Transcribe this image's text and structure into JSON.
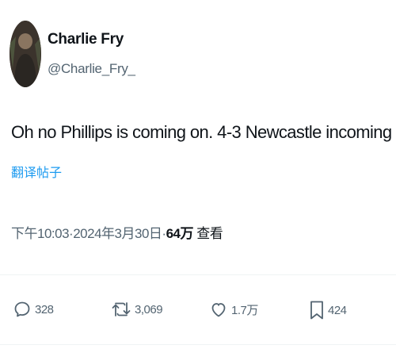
{
  "author": {
    "display_name": "Charlie Fry",
    "handle": "@Charlie_Fry_"
  },
  "tweet": {
    "text": "Oh no Phillips is coming on. 4-3 Newcastle incoming",
    "translate_label": "翻译帖子",
    "time": "下午10:03",
    "separator": "·",
    "date": "2024年3月30日",
    "views_count": "64万",
    "views_label": "查看"
  },
  "actions": {
    "replies": "328",
    "retweets": "3,069",
    "likes": "1.7万",
    "bookmarks": "424"
  },
  "icons": {
    "reply": "reply-icon",
    "retweet": "retweet-icon",
    "like": "like-icon",
    "bookmark": "bookmark-icon"
  },
  "colors": {
    "link": "#1d9bf0",
    "secondary": "#536471",
    "primary": "#0f1419"
  }
}
